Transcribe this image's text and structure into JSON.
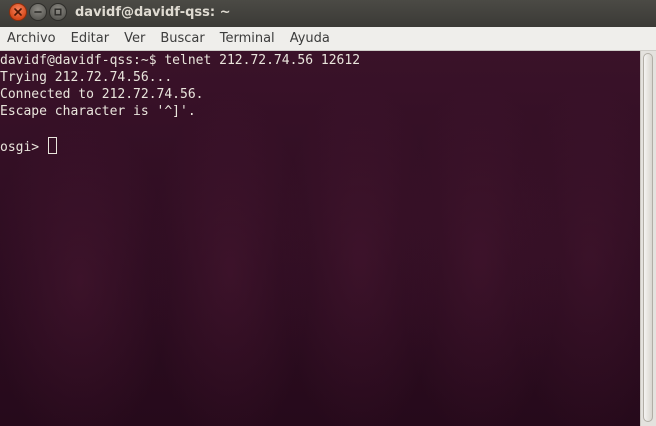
{
  "window": {
    "title": "davidf@davidf-qss: ~",
    "controls": {
      "close_icon": "close-icon",
      "minimize_icon": "minimize-icon",
      "maximize_icon": "maximize-icon"
    }
  },
  "menubar": {
    "items": [
      "Archivo",
      "Editar",
      "Ver",
      "Buscar",
      "Terminal",
      "Ayuda"
    ]
  },
  "terminal": {
    "lines": [
      "davidf@davidf-qss:~$ telnet 212.72.74.56 12612",
      "Trying 212.72.74.56...",
      "Connected to 212.72.74.56.",
      "Escape character is '^]'.",
      "",
      "osgi> "
    ],
    "prompt": "osgi> "
  },
  "colors": {
    "terminal_background": "#2c0c20",
    "terminal_text": "#e9e5dc",
    "titlebar": "#3b3a36",
    "close_button": "#d64a1c"
  }
}
